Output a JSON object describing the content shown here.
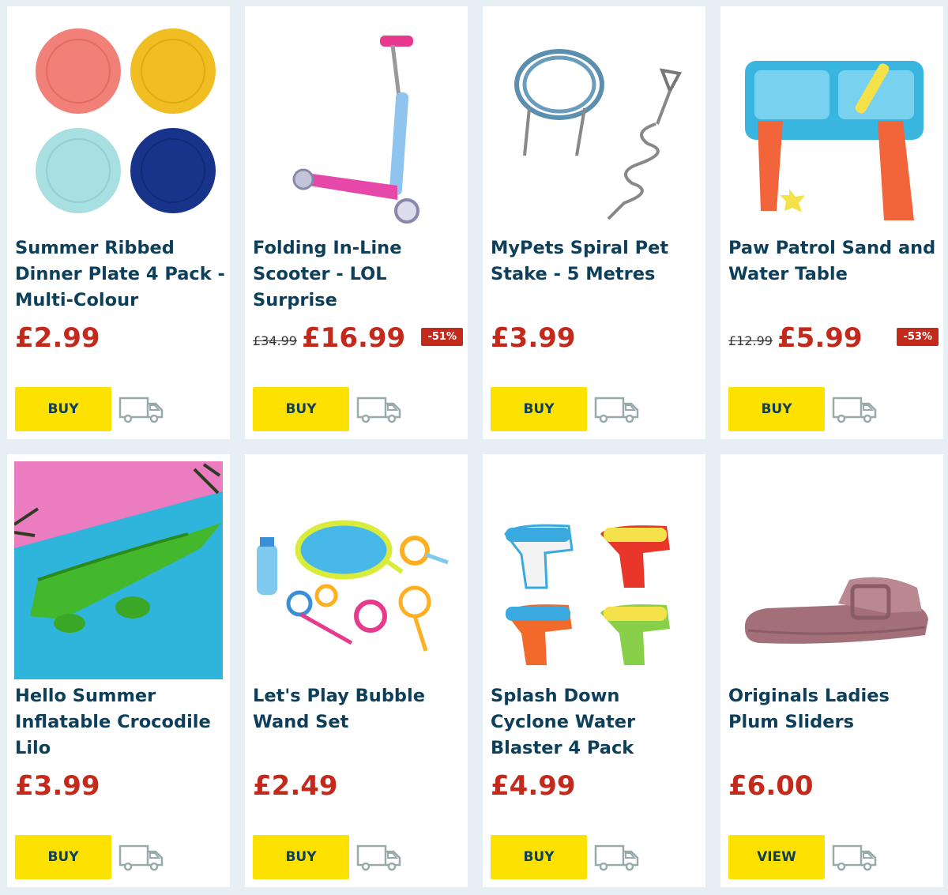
{
  "products": [
    {
      "title": "Summer Ribbed Dinner Plate 4 Pack - Multi-Colour",
      "price": "£2.99",
      "old_price": "",
      "discount": "",
      "button": "BUY",
      "icon": "delivery-van-icon"
    },
    {
      "title": "Folding In-Line Scooter - LOL Surprise",
      "price": "£16.99",
      "old_price": "£34.99",
      "discount": "-51%",
      "button": "BUY",
      "icon": "delivery-van-icon"
    },
    {
      "title": "MyPets Spiral Pet Stake - 5 Metres",
      "price": "£3.99",
      "old_price": "",
      "discount": "",
      "button": "BUY",
      "icon": "delivery-van-icon"
    },
    {
      "title": "Paw Patrol Sand and Water Table",
      "price": "£5.99",
      "old_price": "£12.99",
      "discount": "-53%",
      "button": "BUY",
      "icon": "delivery-van-icon"
    },
    {
      "title": "Hello Summer Inflatable Crocodile Lilo",
      "price": "£3.99",
      "old_price": "",
      "discount": "",
      "button": "BUY",
      "icon": "delivery-van-icon"
    },
    {
      "title": "Let's Play Bubble Wand Set",
      "price": "£2.49",
      "old_price": "",
      "discount": "",
      "button": "BUY",
      "icon": "delivery-van-icon"
    },
    {
      "title": "Splash Down Cyclone Water Blaster 4 Pack",
      "price": "£4.99",
      "old_price": "",
      "discount": "",
      "button": "BUY",
      "icon": "delivery-van-icon"
    },
    {
      "title": "Originals Ladies Plum Sliders",
      "price": "£6.00",
      "old_price": "",
      "discount": "",
      "button": "VIEW",
      "icon": "delivery-van-icon"
    }
  ],
  "colors": {
    "accent_yellow": "#fde100",
    "price_red": "#c42a1c",
    "title_blue": "#0d3f5a",
    "background": "#e6eff3"
  }
}
